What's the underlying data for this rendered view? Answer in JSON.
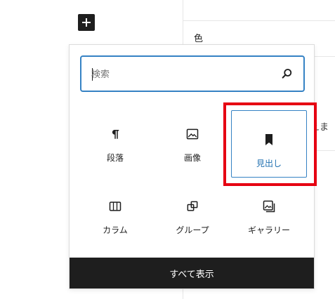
{
  "background": {
    "color_label": "色",
    "partial_text": "えま"
  },
  "inserter": {
    "search": {
      "placeholder": "検索",
      "value": ""
    },
    "blocks": [
      {
        "label": "段落",
        "icon": "paragraph-icon"
      },
      {
        "label": "画像",
        "icon": "image-icon"
      },
      {
        "label": "見出し",
        "icon": "heading-bookmark-icon",
        "selected": true
      },
      {
        "label": "カラム",
        "icon": "columns-icon"
      },
      {
        "label": "グループ",
        "icon": "group-icon"
      },
      {
        "label": "ギャラリー",
        "icon": "gallery-icon"
      }
    ],
    "show_all_label": "すべて表示"
  },
  "colors": {
    "accent": "#3582c4",
    "selected_text": "#2271b1",
    "highlight": "#e60012",
    "dark": "#1e1e1e"
  }
}
